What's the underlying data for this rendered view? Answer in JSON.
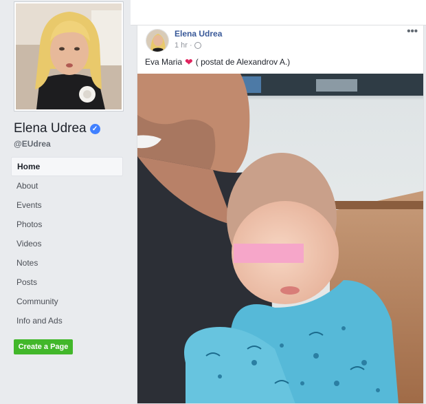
{
  "page": {
    "name": "Elena Udrea",
    "handle": "@EUdrea",
    "verified": true,
    "accent_color": "#4080ff"
  },
  "nav": {
    "items": [
      {
        "label": "Home",
        "active": true
      },
      {
        "label": "About",
        "active": false
      },
      {
        "label": "Events",
        "active": false
      },
      {
        "label": "Photos",
        "active": false
      },
      {
        "label": "Videos",
        "active": false
      },
      {
        "label": "Notes",
        "active": false
      },
      {
        "label": "Posts",
        "active": false
      },
      {
        "label": "Community",
        "active": false
      },
      {
        "label": "Info and Ads",
        "active": false
      }
    ],
    "create_page_label": "Create a Page"
  },
  "post": {
    "author": "Elena Udrea",
    "time": "1 hr",
    "separator": "·",
    "audience_icon": "globe-icon",
    "more_icon": "•••",
    "text_before": "Eva Maria",
    "emoji": "❤",
    "text_after": "( postat de Alexandrov A.)",
    "heart_color": "#e0245e"
  }
}
